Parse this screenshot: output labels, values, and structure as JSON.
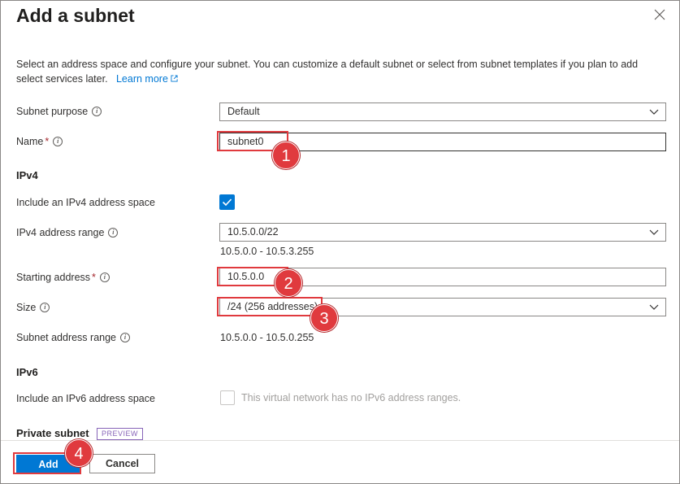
{
  "dialog": {
    "title": "Add a subnet",
    "description": "Select an address space and configure your subnet. You can customize a default subnet or select from subnet templates if you plan to add select services later.",
    "learn_more": "Learn more",
    "close_icon": "close-icon"
  },
  "form": {
    "subnet_purpose": {
      "label": "Subnet purpose",
      "value": "Default"
    },
    "name": {
      "label": "Name",
      "required": "*",
      "value": "subnet0"
    },
    "ipv4_section": "IPv4",
    "include_ipv4": {
      "label": "Include an IPv4 address space",
      "checked": true
    },
    "ipv4_range": {
      "label": "IPv4 address range",
      "value": "10.5.0.0/22",
      "range_text": "10.5.0.0 - 10.5.3.255"
    },
    "starting_address": {
      "label": "Starting address",
      "required": "*",
      "value": "10.5.0.0"
    },
    "size": {
      "label": "Size",
      "value": "/24 (256 addresses)"
    },
    "subnet_range": {
      "label": "Subnet address range",
      "value": "10.5.0.0 - 10.5.0.255"
    },
    "ipv6_section": "IPv6",
    "include_ipv6": {
      "label": "Include an IPv6 address space",
      "checked": false,
      "disabled_text": "This virtual network has no IPv6 address ranges."
    },
    "private_subnet": {
      "label": "Private subnet",
      "badge": "PREVIEW"
    }
  },
  "footer": {
    "add_label": "Add",
    "cancel_label": "Cancel"
  },
  "callouts": [
    "1",
    "2",
    "3",
    "4"
  ],
  "colors": {
    "accent": "#0078d4",
    "highlight": "#e03a3e",
    "preview_badge": "#8764b8"
  }
}
